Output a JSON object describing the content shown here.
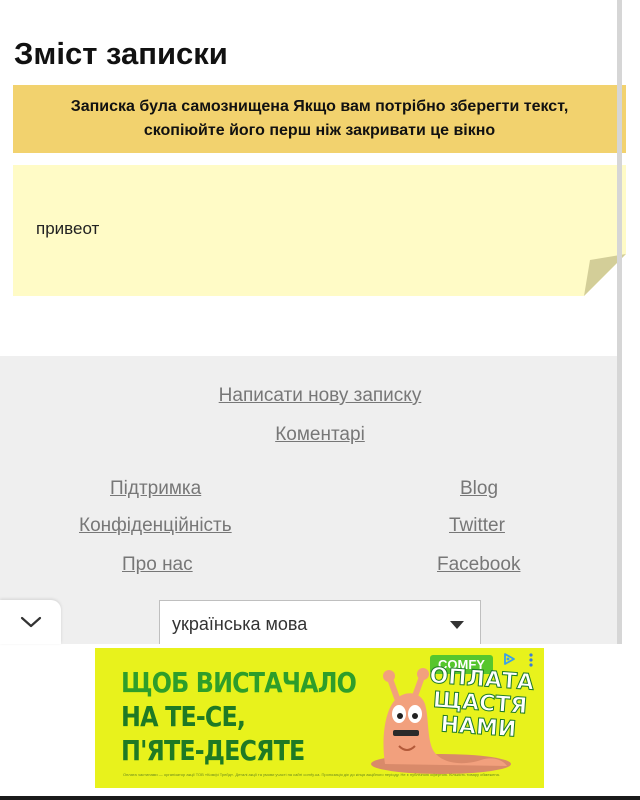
{
  "page": {
    "title": "Зміст записки"
  },
  "notice": {
    "line1": "Записка була самознищена Якщо вам потрібно зберегти текст,",
    "line2": "скопіюйте його перш ніж закривати це вікно"
  },
  "note": {
    "content": "привеот"
  },
  "footer": {
    "new_note": "Написати нову записку",
    "comments": "Коментарі",
    "support": "Підтримка",
    "privacy": "Конфіденційність",
    "about": "Про нас",
    "blog": "Blog",
    "twitter": "Twitter",
    "facebook": "Facebook",
    "language": {
      "selected": "українська мова"
    }
  },
  "ad": {
    "headline": [
      "ЩОБ ВИСТАЧАЛО",
      "НА ТЕ-СЕ,",
      "П'ЯТЕ-ДЕСЯТЕ"
    ],
    "brand": "COMFY",
    "slogan": [
      "ОПЛАТА",
      "ЩАСТЯ",
      "НАМИ"
    ],
    "fineprint": "Оплата частинами — організатор акції ТОВ «Комфі Трейд». Деталі акції та умови участі на сайті comfy.ua. Пропозиція діє до кінця акційного періоду. Не є публічною офертою. Кількість товару обмежена.",
    "colors": {
      "background": "#e8f21c",
      "headline": "#2e9e2a",
      "brand": "#56c62d"
    },
    "icons": [
      "adchoices-icon",
      "more-vertical-icon"
    ]
  },
  "colors": {
    "notice_bg": "#f2d26e",
    "note_bg": "#fffbc6",
    "footer_bg": "#efefef",
    "link": "#777777"
  }
}
